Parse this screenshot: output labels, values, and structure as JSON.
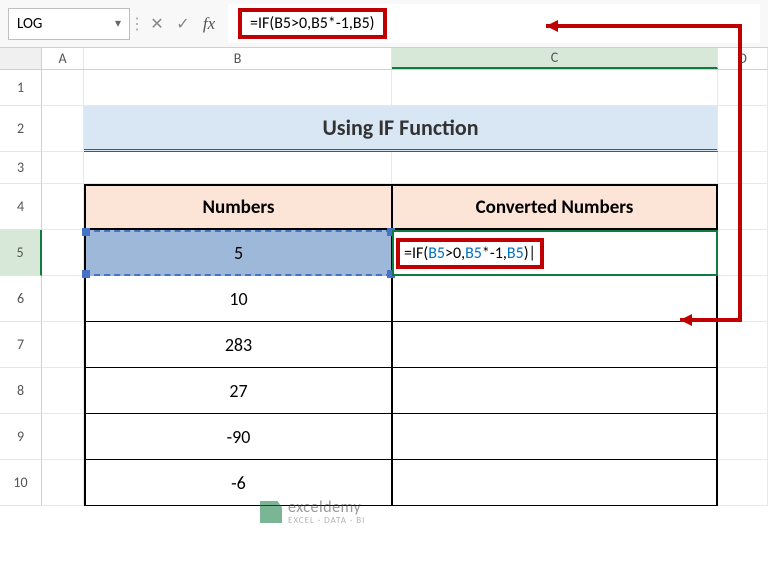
{
  "nameBox": {
    "value": "LOG"
  },
  "formulaBar": {
    "cancel": "✕",
    "confirm": "✓",
    "fx": "fx",
    "formula": "=IF(B5>0,B5*-1,B5)"
  },
  "columns": {
    "a": "A",
    "b": "B",
    "c": "C",
    "d": "D"
  },
  "rows": {
    "r1": "1",
    "r2": "2",
    "r3": "3",
    "r4": "4",
    "r5": "5",
    "r6": "6",
    "r7": "7",
    "r8": "8",
    "r9": "9",
    "r10": "10"
  },
  "title": "Using IF Function",
  "headers": {
    "numbers": "Numbers",
    "converted": "Converted Numbers"
  },
  "data": {
    "b5": "5",
    "b6": "10",
    "b7": "283",
    "b8": "27",
    "b9": "-90",
    "b10": "-6"
  },
  "cellFormula": {
    "prefix": "=IF(",
    "ref1": "B5",
    "mid1": ">0,",
    "ref2": "B5",
    "mid2": "*-1,",
    "ref3": "B5",
    "suffix": ")"
  },
  "watermark": {
    "brand": "exceldemy",
    "tagline": "EXCEL · DATA · BI"
  },
  "colors": {
    "annotation": "#c00000"
  }
}
